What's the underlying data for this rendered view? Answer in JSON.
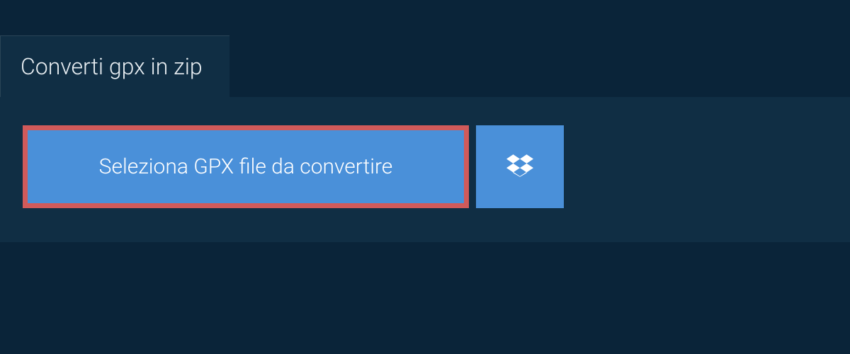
{
  "tab": {
    "label": "Converti gpx in zip"
  },
  "actions": {
    "select_file_label": "Seleziona GPX file da convertire"
  }
}
